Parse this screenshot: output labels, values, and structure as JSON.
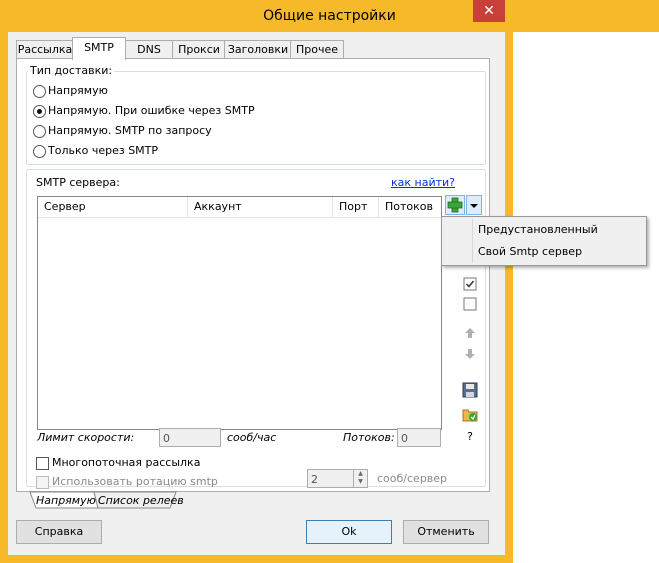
{
  "window": {
    "title": "Общие настройки",
    "close_glyph": "✕"
  },
  "tabs": [
    "Рассылка",
    "SMTP",
    "DNS",
    "Прокси",
    "Заголовки",
    "Прочее"
  ],
  "delivery": {
    "label": "Тип доставки:",
    "options": [
      {
        "label": "Напрямую",
        "checked": false
      },
      {
        "label": "Напрямую. При ошибке через SMTP",
        "checked": true
      },
      {
        "label": "Напрямую. SMTP по запросу",
        "checked": false
      },
      {
        "label": "Только через SMTP",
        "checked": false
      }
    ]
  },
  "smtp": {
    "label": "SMTP сервера:",
    "find_link": "как найти?",
    "columns": [
      "Сервер",
      "Аккаунт",
      "Порт",
      "Потоков"
    ],
    "add_menu": [
      "Предустановленный",
      "Свой Smtp сервер"
    ],
    "help_glyph": "?",
    "icons": [
      "add-icon",
      "dropdown-arrow-icon",
      "check-all-icon",
      "uncheck-all-icon",
      "move-up-icon",
      "move-down-icon",
      "save-icon",
      "import-icon"
    ]
  },
  "speed": {
    "label": "Лимит скорости:",
    "value": "0",
    "unit": "сооб/час",
    "threads_label": "Потоков:",
    "threads_value": "0"
  },
  "multithread": {
    "label": "Многопоточная рассылка",
    "checked": false
  },
  "rotation": {
    "label": "Использовать ротацию smtp",
    "checked": false,
    "value": "2",
    "unit": "сооб/сервер"
  },
  "bottom_tabs": [
    "Напрямую",
    "Список релеев"
  ],
  "buttons": {
    "help": "Справка",
    "ok": "Ok",
    "cancel": "Отменить"
  },
  "colors": {
    "frame": "#f5b92a",
    "close": "#c7403a",
    "link": "#0033cc",
    "add_green": "#3aa53a"
  }
}
